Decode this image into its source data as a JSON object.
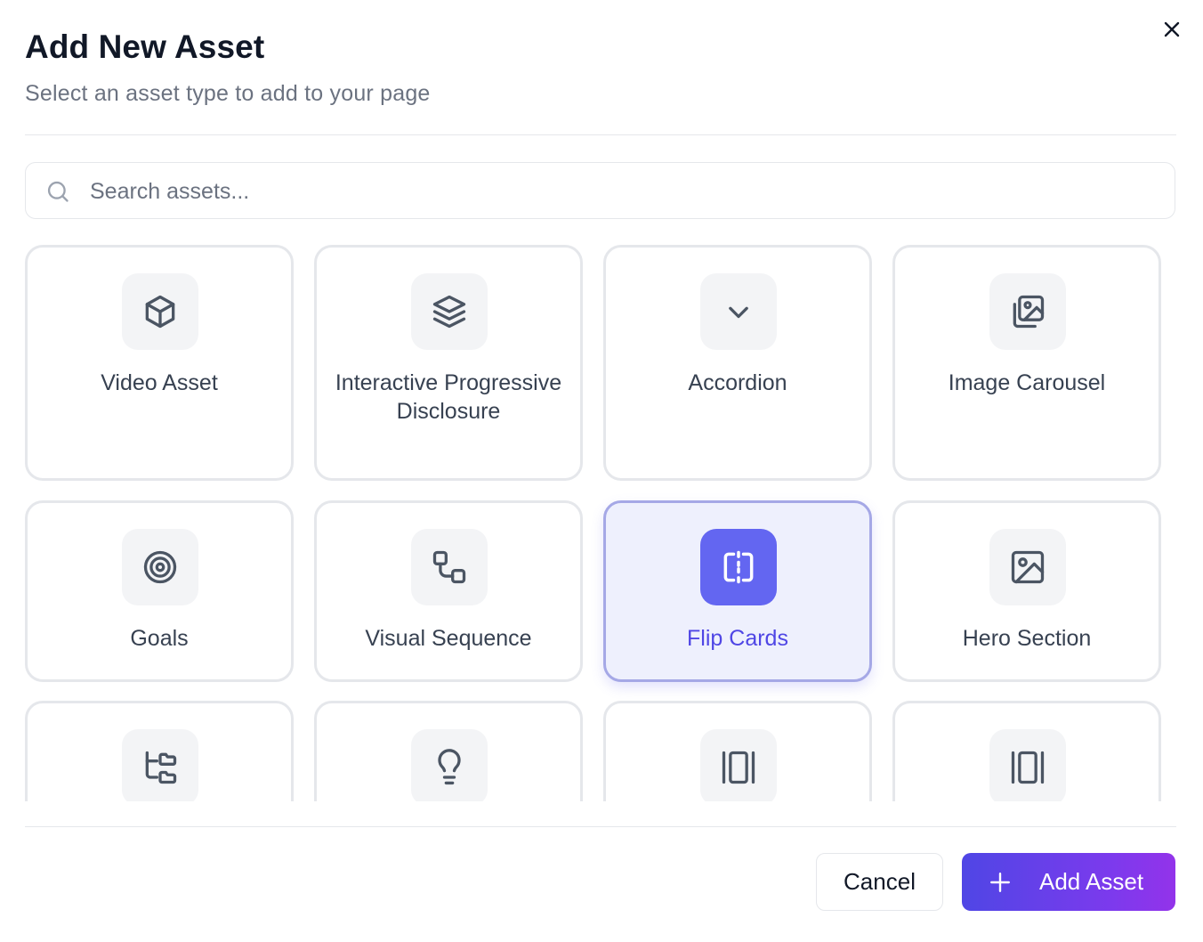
{
  "dialog": {
    "title": "Add New Asset",
    "subtitle": "Select an asset type to add to your page"
  },
  "search": {
    "placeholder": "Search assets...",
    "value": ""
  },
  "assets": [
    {
      "label": "Video Asset",
      "icon": "cube-icon",
      "selected": false
    },
    {
      "label": "Interactive Progressive Disclosure",
      "icon": "layers-icon",
      "selected": false
    },
    {
      "label": "Accordion",
      "icon": "chevron-down-icon",
      "selected": false
    },
    {
      "label": "Image Carousel",
      "icon": "images-icon",
      "selected": false
    },
    {
      "label": "Goals",
      "icon": "target-icon",
      "selected": false
    },
    {
      "label": "Visual Sequence",
      "icon": "workflow-icon",
      "selected": false
    },
    {
      "label": "Flip Cards",
      "icon": "flip-icon",
      "selected": true
    },
    {
      "label": "Hero Section",
      "icon": "image-icon",
      "selected": false
    },
    {
      "label": "",
      "icon": "folder-tree-icon",
      "selected": false
    },
    {
      "label": "",
      "icon": "lightbulb-icon",
      "selected": false
    },
    {
      "label": "",
      "icon": "gallery-vertical-icon",
      "selected": false
    },
    {
      "label": "",
      "icon": "gallery-vertical-icon",
      "selected": false
    }
  ],
  "footer": {
    "cancel_label": "Cancel",
    "add_label": "Add Asset"
  },
  "colors": {
    "accent": "#6366f1",
    "accent_text": "#4f46e5",
    "selected_bg": "#eef0fd",
    "border": "#e5e7eb",
    "icon_bg": "#f3f4f6"
  }
}
